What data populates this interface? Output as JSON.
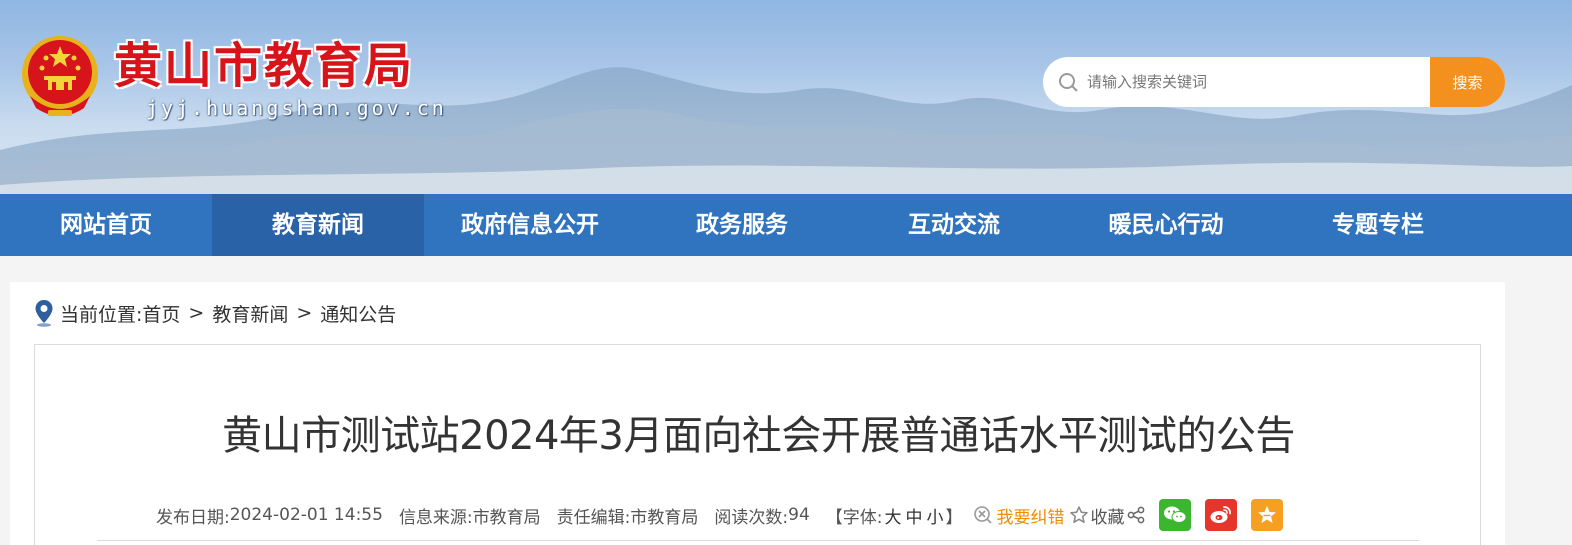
{
  "header": {
    "title": "黄山市教育局",
    "domain": "jyj.huangshan.gov.cn",
    "search": {
      "placeholder": "请输入搜索关键词",
      "button_label": "搜索"
    }
  },
  "nav": {
    "items": [
      {
        "label": "网站首页",
        "active": false
      },
      {
        "label": "教育新闻",
        "active": true
      },
      {
        "label": "政府信息公开",
        "active": false
      },
      {
        "label": "政务服务",
        "active": false
      },
      {
        "label": "互动交流",
        "active": false
      },
      {
        "label": "暖民心行动",
        "active": false
      },
      {
        "label": "专题专栏",
        "active": false
      }
    ]
  },
  "breadcrumb": {
    "prefix": "当前位置:",
    "items": [
      "首页",
      "教育新闻",
      "通知公告"
    ],
    "separator": ">"
  },
  "article": {
    "title": "黄山市测试站2024年3月面向社会开展普通话水平测试的公告",
    "meta": {
      "date_label": "发布日期:",
      "date": "2024-02-01 14:55",
      "source_label": "信息来源:",
      "source": "市教育局",
      "editor_label": "责任编辑:",
      "editor": "市教育局",
      "views_label": "阅读次数:",
      "views": "94",
      "font_label_open": "【字体:",
      "font_large": "大",
      "font_medium": "中",
      "font_small": "小",
      "font_label_close": "】",
      "error_label": "我要纠错",
      "favorite_label": "收藏"
    }
  },
  "colors": {
    "nav_bg": "#3073be",
    "nav_active_bg": "#2a62a8",
    "title_red": "#d8141b",
    "search_button": "#f4901e",
    "error_link": "#f08c00",
    "wechat": "#3ab72f",
    "weibo": "#e6352a",
    "qzone": "#f6a021"
  }
}
